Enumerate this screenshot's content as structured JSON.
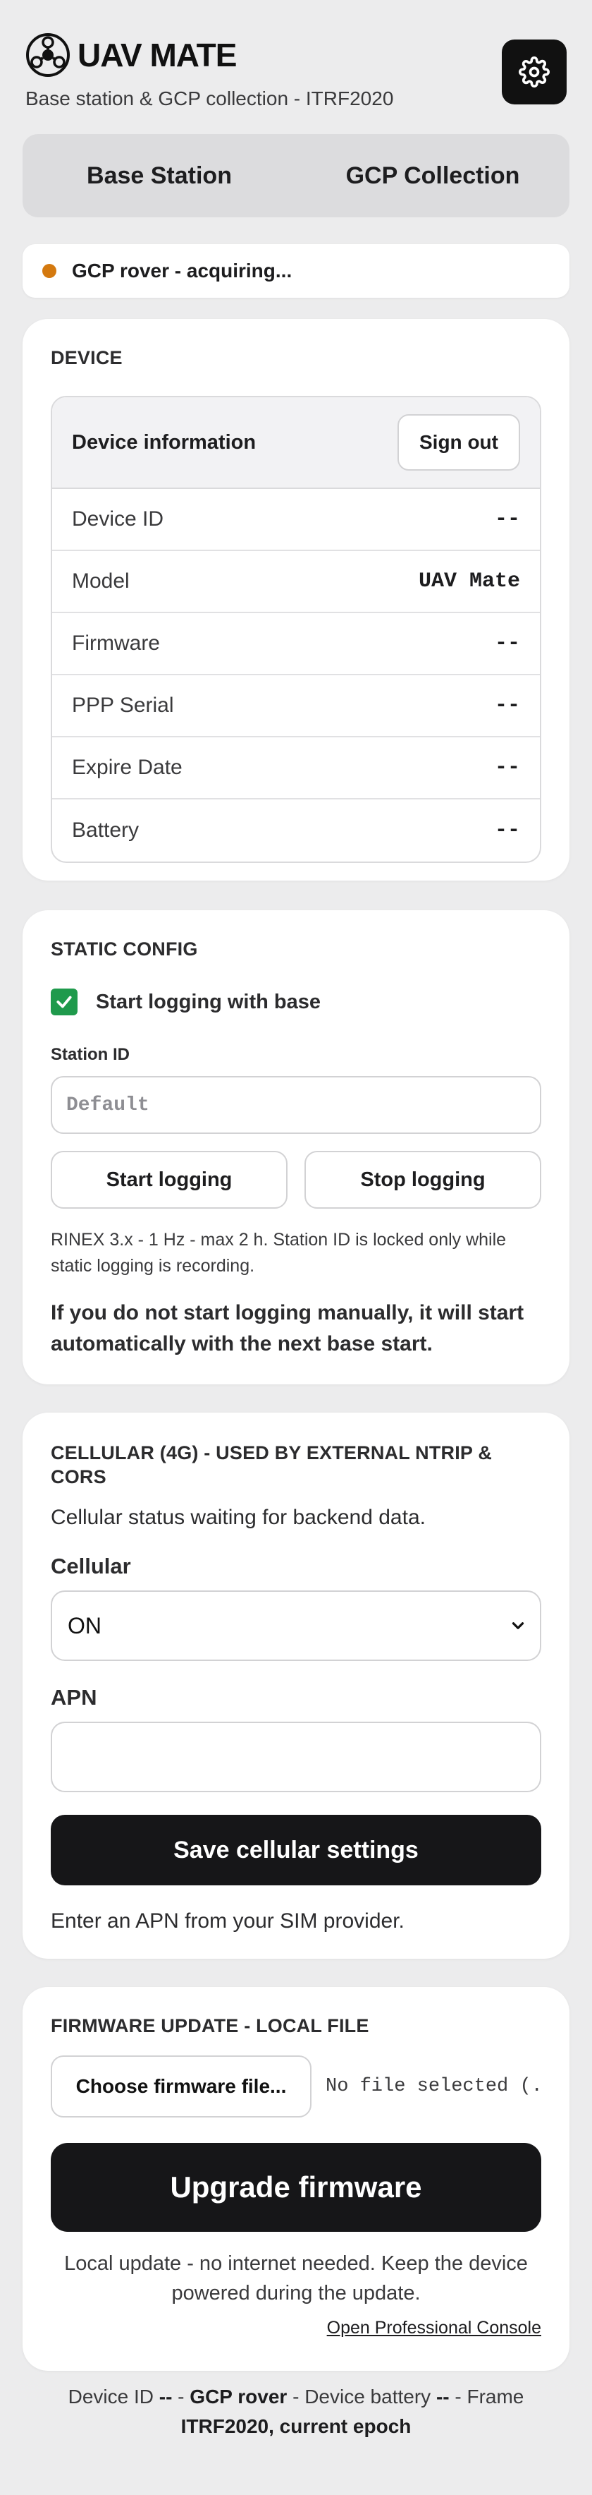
{
  "app": {
    "title": "UAV MATE",
    "subtitle": "Base station & GCP collection - ITRF2020",
    "settings_icon": "gear-icon",
    "logo_icon": "drone-logo-icon"
  },
  "tabs": [
    {
      "label": "Base Station"
    },
    {
      "label": "GCP Collection"
    }
  ],
  "status": {
    "text": "GCP rover - acquiring...",
    "dot_color": "#d4790f"
  },
  "device": {
    "title": "DEVICE",
    "header_label": "Device information",
    "sign_out": "Sign out",
    "rows": [
      {
        "label": "Device ID",
        "value": "--"
      },
      {
        "label": "Model",
        "value": "UAV Mate"
      },
      {
        "label": "Firmware",
        "value": "--"
      },
      {
        "label": "PPP Serial",
        "value": "--"
      },
      {
        "label": "Expire Date",
        "value": "--"
      },
      {
        "label": "Battery",
        "value": "--"
      }
    ]
  },
  "static_config": {
    "title": "STATIC CONFIG",
    "checkbox_label": "Start logging with base",
    "checkbox_checked": true,
    "station_id_label": "Station ID",
    "station_id_placeholder": "Default",
    "start_button": "Start logging",
    "stop_button": "Stop logging",
    "hint": "RINEX 3.x - 1 Hz - max 2 h. Station ID is locked only while static logging is recording.",
    "note": "If you do not start logging manually, it will start automatically with the next base start."
  },
  "cellular": {
    "title": "CELLULAR (4G) - USED BY EXTERNAL NTRIP & CORS",
    "status": "Cellular status waiting for backend data.",
    "cellular_label": "Cellular",
    "cellular_value": "ON",
    "apn_label": "APN",
    "apn_value": "",
    "save_button": "Save cellular settings",
    "hint": "Enter an APN from your SIM provider."
  },
  "firmware": {
    "title": "FIRMWARE UPDATE - LOCAL FILE",
    "choose_button": "Choose firmware file...",
    "no_file": "No file selected (.",
    "upgrade_button": "Upgrade firmware",
    "hint": "Local update - no internet needed. Keep the device powered during the update.",
    "console_link": "Open Professional Console"
  },
  "footer": {
    "device_id_label": "Device ID",
    "device_id_value": "--",
    "mode": "GCP rover",
    "battery_label": "Device battery",
    "battery_value": "--",
    "frame_label": "Frame",
    "frame_value": "ITRF2020, current epoch"
  }
}
